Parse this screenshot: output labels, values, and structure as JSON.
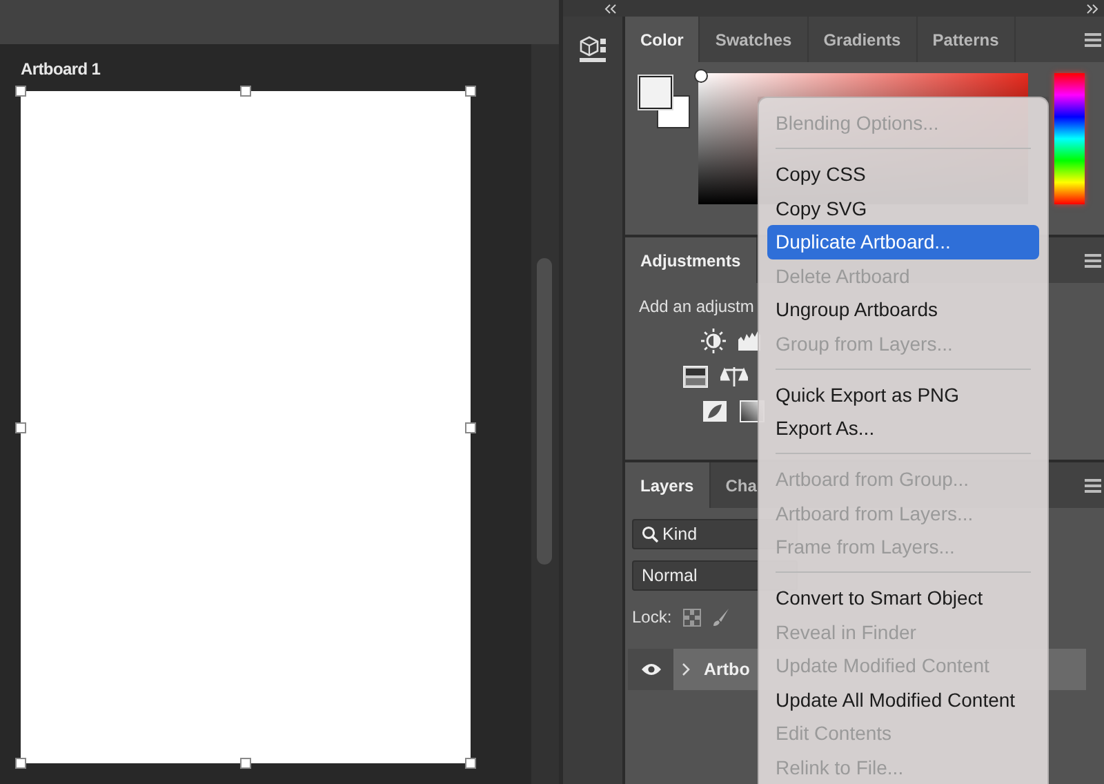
{
  "canvas": {
    "artboard_title": "Artboard 1"
  },
  "panels": {
    "color": {
      "tabs": [
        {
          "label": "Color",
          "selected": true
        },
        {
          "label": "Swatches",
          "selected": false
        },
        {
          "label": "Gradients",
          "selected": false
        },
        {
          "label": "Patterns",
          "selected": false
        }
      ]
    },
    "adjustments": {
      "tabs": [
        {
          "label": "Adjustments",
          "selected": true
        }
      ],
      "hint": "Add an adjustm"
    },
    "layers": {
      "tabs": [
        {
          "label": "Layers",
          "selected": true
        },
        {
          "label": "Cha",
          "selected": false
        }
      ],
      "filter": {
        "value": "Kind"
      },
      "blend_mode": {
        "value": "Normal"
      },
      "lock_label": "Lock:",
      "items": [
        {
          "name": "Artbo",
          "visible": true,
          "expanded": false,
          "selected": true
        }
      ]
    }
  },
  "context_menu": {
    "items": [
      {
        "kind": "item",
        "label": "Blending Options...",
        "disabled": true,
        "selected": false
      },
      {
        "kind": "separator"
      },
      {
        "kind": "item",
        "label": "Copy CSS",
        "disabled": false,
        "selected": false
      },
      {
        "kind": "item",
        "label": "Copy SVG",
        "disabled": false,
        "selected": false
      },
      {
        "kind": "item",
        "label": "Duplicate Artboard...",
        "disabled": false,
        "selected": true
      },
      {
        "kind": "item",
        "label": "Delete Artboard",
        "disabled": true,
        "selected": false
      },
      {
        "kind": "item",
        "label": "Ungroup Artboards",
        "disabled": false,
        "selected": false
      },
      {
        "kind": "item",
        "label": "Group from Layers...",
        "disabled": true,
        "selected": false
      },
      {
        "kind": "separator"
      },
      {
        "kind": "item",
        "label": "Quick Export as PNG",
        "disabled": false,
        "selected": false
      },
      {
        "kind": "item",
        "label": "Export As...",
        "disabled": false,
        "selected": false
      },
      {
        "kind": "separator"
      },
      {
        "kind": "item",
        "label": "Artboard from Group...",
        "disabled": true,
        "selected": false
      },
      {
        "kind": "item",
        "label": "Artboard from Layers...",
        "disabled": true,
        "selected": false
      },
      {
        "kind": "item",
        "label": "Frame from Layers...",
        "disabled": true,
        "selected": false
      },
      {
        "kind": "separator"
      },
      {
        "kind": "item",
        "label": "Convert to Smart Object",
        "disabled": false,
        "selected": false
      },
      {
        "kind": "item",
        "label": "Reveal in Finder",
        "disabled": true,
        "selected": false
      },
      {
        "kind": "item",
        "label": "Update Modified Content",
        "disabled": true,
        "selected": false
      },
      {
        "kind": "item",
        "label": "Update All Modified Content",
        "disabled": false,
        "selected": false
      },
      {
        "kind": "item",
        "label": "Edit Contents",
        "disabled": true,
        "selected": false
      },
      {
        "kind": "item",
        "label": "Relink to File...",
        "disabled": true,
        "selected": false
      }
    ]
  }
}
